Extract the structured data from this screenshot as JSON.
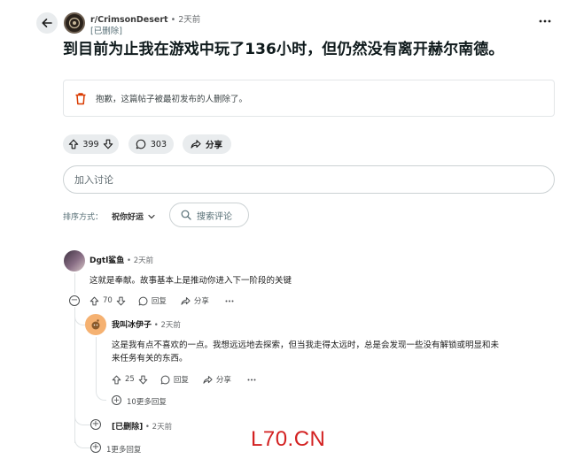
{
  "header": {
    "subreddit": "r/CrimsonDesert",
    "time": "2天前",
    "author": "[已删除]"
  },
  "post": {
    "title": "到目前为止我在游戏中玩了136小时，但仍然没有离开赫尔南德。",
    "removed_notice": "抱歉，这篇帖子被最初发布的人删除了。",
    "votes": "399",
    "comments": "303",
    "share_label": "分享"
  },
  "join": {
    "placeholder": "加入讨论"
  },
  "sort": {
    "label": "排序方式：",
    "value": "祝你好运",
    "search_label": "搜索评论"
  },
  "comments": [
    {
      "author": "Dgtl鲨鱼",
      "time": "2天前",
      "body": "这就是奉献。故事基本上是推动你进入下一阶段的关键",
      "votes": "70",
      "reply_label": "回复",
      "share_label": "分享"
    },
    {
      "author": "我叫冰伊子",
      "time": "2天前",
      "body_line1": "这是我有点不喜欢的一点。我想远远地去探索，但当我走得太远时，总是会发现一些没有解锁或明显和未",
      "body_line2": "来任务有关的东西。",
      "votes": "25",
      "reply_label": "回复",
      "share_label": "分享",
      "more_replies": "10更多回复"
    },
    {
      "author": "[已删除]",
      "time": "2天前"
    }
  ],
  "more_replies_bottom": "1更多回复",
  "watermark": "L70.CN",
  "colors": {
    "accent_red": "#d32121",
    "pill_bg": "#e9ecee"
  }
}
